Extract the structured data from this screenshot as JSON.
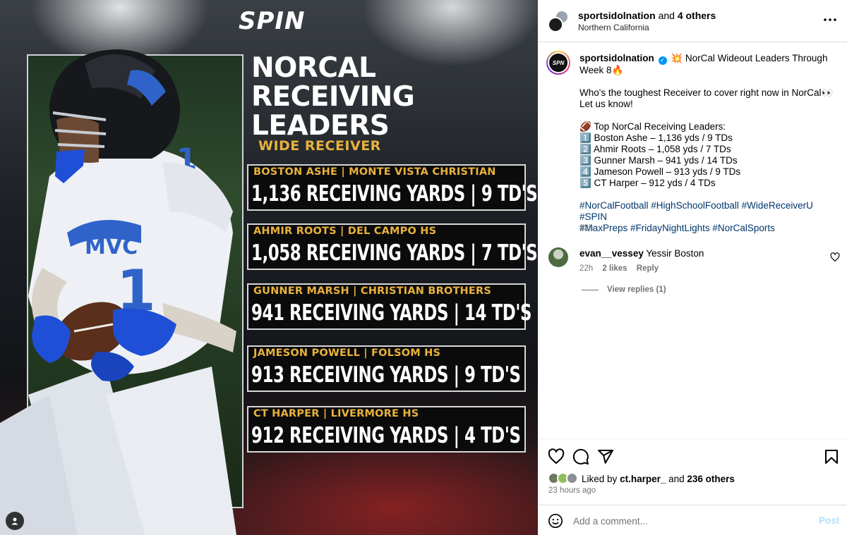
{
  "post_image": {
    "logo": "SPIN",
    "headline": "NORCAL RECEIVING LEADERS",
    "position_label": "WIDE RECEIVER",
    "cards": [
      {
        "sub": "BOSTON ASHE | MONTE VISTA CHRISTIAN",
        "main": "1,136 RECEIVING YARDS  |  9 TD'S"
      },
      {
        "sub": "AHMIR ROOTS | DEL CAMPO HS",
        "main": "1,058 RECEIVING YARDS  |  7 TD'S"
      },
      {
        "sub": "GUNNER MARSH | CHRISTIAN BROTHERS",
        "main": "941 RECEIVING YARDS  |  14 TD'S"
      },
      {
        "sub": "JAMESON POWELL  | FOLSOM HS",
        "main": "913 RECEIVING YARDS  |  9 TD'S"
      },
      {
        "sub": "CT HARPER | LIVERMORE HS",
        "main": "912 RECEIVING YARDS  |  4 TD'S"
      }
    ]
  },
  "header": {
    "username": "sportsidolnation",
    "and_text": "and",
    "others": "4 others",
    "location": "Northern California",
    "more_icon": "more-horizontal-icon"
  },
  "caption": {
    "username": "sportsidolnation",
    "title": "💥 NorCal Wideout Leaders Through Week 8🔥",
    "question": "Who's the toughest Receiver to cover right now in NorCal👀",
    "cta": "Let us know!",
    "list_title": "🏈 Top NorCal Receiving Leaders:",
    "leaders": [
      "1️⃣ Boston Ashe – 1,136 yds / 9 TDs",
      "2️⃣ Ahmir Roots – 1,058 yds / 7 TDs",
      "3️⃣ Gunner Marsh – 941 yds / 14 TDs",
      "4️⃣ Jameson Powell – 913 yds / 9 TDs",
      "5️⃣ CT Harper – 912 yds / 4 TDs"
    ],
    "hashtags_line1": "#NorCalFootball #HighSchoolFootball #WideReceiverU #SPIN",
    "hashtags_line2": "#MaxPreps #FridayNightLights #NorCalSports",
    "time": "23h"
  },
  "comment": {
    "username": "evan__vessey",
    "text": "Yessir Boston",
    "time": "22h",
    "likes": "2 likes",
    "reply": "Reply",
    "view_replies": "View replies (1)"
  },
  "actions": {
    "liked_by_prefix": "Liked by",
    "liked_by_user": "ct.harper_",
    "liked_by_and": "and",
    "liked_by_others": "236 others",
    "time": "23 hours ago"
  },
  "add_comment": {
    "placeholder": "Add a comment...",
    "post_label": "Post"
  },
  "colors": {
    "gold": "#e8b23c",
    "link": "#00376b",
    "post_disabled": "#b2dffc",
    "verified": "#0095f6"
  }
}
